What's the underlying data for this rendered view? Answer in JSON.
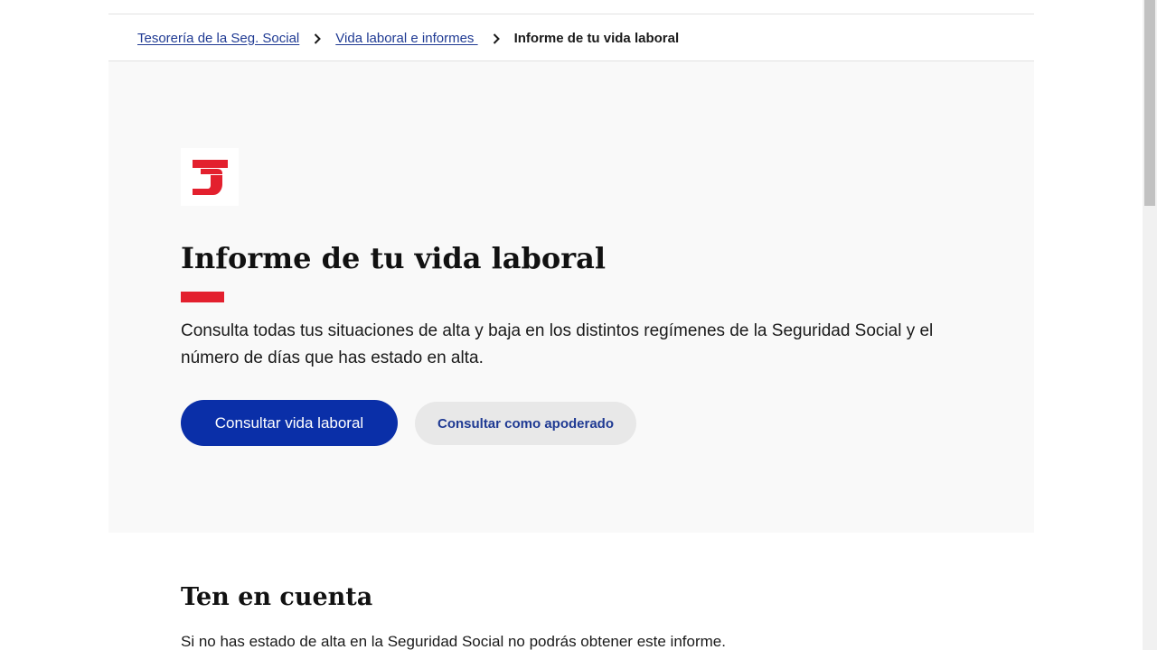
{
  "breadcrumb": {
    "items": [
      {
        "label": "Tesorería de la Seg. Social"
      },
      {
        "label": "Vida laboral e informes "
      }
    ],
    "current": "Informe de tu vida laboral",
    "separator_icon": "chevron-right-icon"
  },
  "hero": {
    "logo_icon": "tgss-logo",
    "title": "Informe de tu vida laboral",
    "description": "Consulta todas tus situaciones de alta y baja en los distintos regímenes de la Seguridad Social y el número de días que has estado en alta.",
    "primary_button": "Consultar vida laboral",
    "secondary_button": "Consultar como apoderado"
  },
  "notice": {
    "title": "Ten en cuenta",
    "text": "Si no has estado de alta en la Seguridad Social no podrás obtener este informe."
  },
  "colors": {
    "accent_red": "#e3202e",
    "primary_blue": "#0a2fa8",
    "link_blue": "#1f3a93",
    "hero_background": "#f9f9f9"
  }
}
